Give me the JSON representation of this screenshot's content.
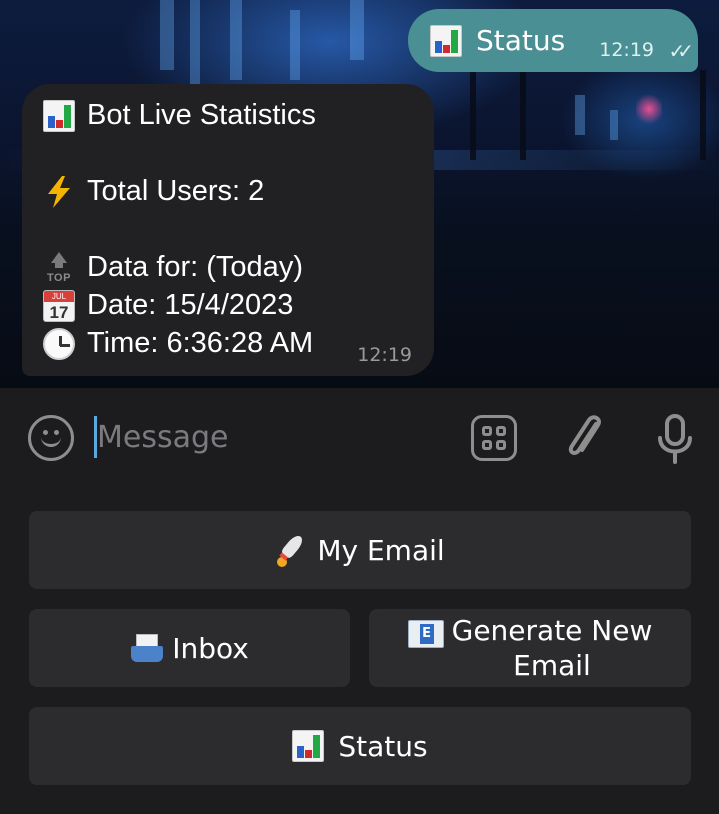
{
  "outgoing": {
    "text": "Status",
    "time": "12:19",
    "read_ticks": "✓✓",
    "icon": "bar-chart-icon"
  },
  "incoming": {
    "time": "12:19",
    "lines": [
      {
        "icon": "bar-chart-icon",
        "text": "Bot Live Statistics"
      },
      {
        "icon": "high-voltage-icon",
        "text": "Total Users: 2"
      },
      {
        "icon": "top-arrow-icon",
        "icon_text": "TOP",
        "text": "Data for: (Today)"
      },
      {
        "icon": "calendar-icon",
        "icon_text": "JUL",
        "icon_day": "17",
        "text": "Date: 15/4/2023"
      },
      {
        "icon": "clock-icon",
        "text": "Time: 6:36:28 AM"
      }
    ]
  },
  "composer": {
    "placeholder": "Message",
    "icons": [
      "emoji-icon",
      "bot-keyboard-icon",
      "attach-icon",
      "microphone-icon"
    ]
  },
  "keyboard": {
    "buttons": [
      {
        "label": "My Email",
        "icon": "rocket-icon"
      },
      {
        "label": "Inbox",
        "icon": "inbox-tray-icon"
      },
      {
        "label": "Generate New\nEmail",
        "icon": "e-mail-icon"
      },
      {
        "label": "Status",
        "icon": "bar-chart-icon"
      }
    ]
  },
  "colors": {
    "outgoing_bubble": "#4a8f93",
    "incoming_bubble": "#212123",
    "panel": "#1c1c1e",
    "key_button": "#2c2c2e",
    "cursor": "#5aa8e0"
  }
}
